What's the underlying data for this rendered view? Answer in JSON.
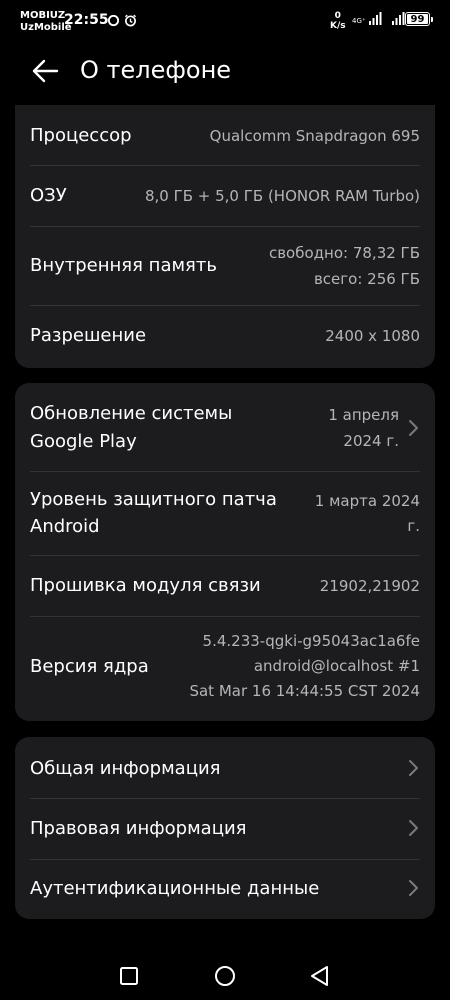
{
  "status_bar": {
    "carrier_line1": "MOBIUZ",
    "carrier_line2": "UzMobile",
    "time": "22:55",
    "net_speed_value": "0",
    "net_speed_unit": "K/s",
    "network_type": "4G⁺",
    "battery_level": "99"
  },
  "header": {
    "title": "О телефоне"
  },
  "device_specs": {
    "processor": {
      "label": "Процессор",
      "value": "Qualcomm Snapdragon 695"
    },
    "ram": {
      "label": "ОЗУ",
      "value": "8,0  ГБ + 5,0 ГБ (HONOR RAM Turbo)"
    },
    "storage": {
      "label": "Внутренняя память",
      "free": "свободно: 78,32  ГБ",
      "total": "всего: 256  ГБ"
    },
    "resolution": {
      "label": "Разрешение",
      "value": "2400 x 1080"
    }
  },
  "software": {
    "google_play_update": {
      "label_line1": "Обновление системы",
      "label_line2": "Google Play",
      "value_line1": "1 апреля",
      "value_line2": "2024 г."
    },
    "security_patch": {
      "label_line1": "Уровень защитного патча",
      "label_line2": "Android",
      "value_line1": "1 марта 2024",
      "value_line2": "г."
    },
    "baseband": {
      "label": "Прошивка модуля связи",
      "value": "21902,21902"
    },
    "kernel": {
      "label": "Версия ядра",
      "value_line1": "5.4.233-qgki-g95043ac1a6fe",
      "value_line2": "android@localhost #1",
      "value_line3": "Sat Mar 16 14:44:55 CST 2024"
    }
  },
  "links": {
    "general_info": "Общая информация",
    "legal_info": "Правовая информация",
    "authentication": "Аутентификационные данные"
  },
  "icons": {
    "back": "arrow-left-icon",
    "chevron": "chevron-right-icon",
    "nav_recent": "square-icon",
    "nav_home": "circle-icon",
    "nav_back": "triangle-icon"
  },
  "colors": {
    "background": "#000000",
    "card": "#1c1c1e",
    "label": "#ffffff",
    "value": "#b5b5b8",
    "divider": "#333336"
  }
}
